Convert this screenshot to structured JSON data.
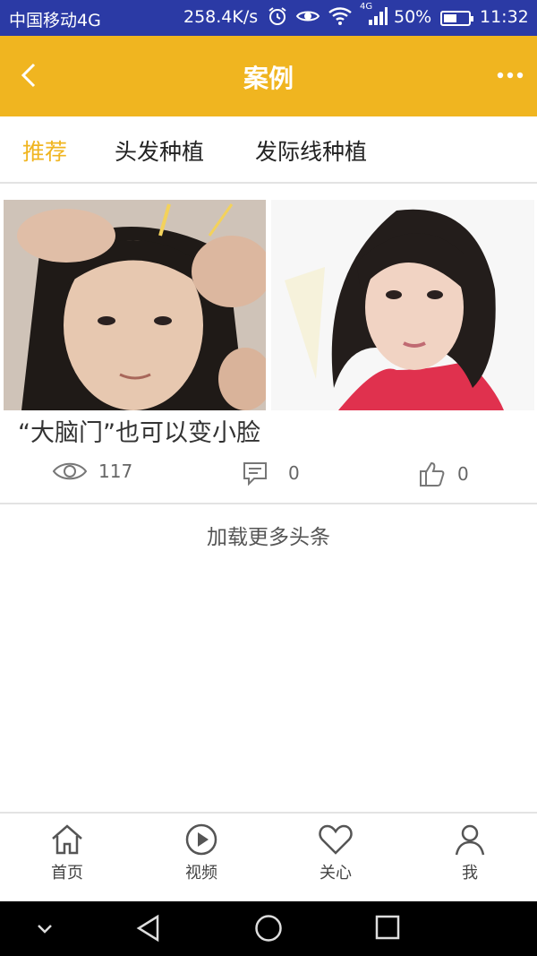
{
  "status_bar": {
    "carrier": "中国移动4G",
    "network_speed": "258.4K/s",
    "network_type": "4G",
    "battery": "50%",
    "battery_level": 0.5,
    "time": "11:32"
  },
  "app_bar": {
    "title": "案例",
    "back_icon": "chevron-left-icon",
    "more_icon": "more-dots-icon",
    "background": "#f0b520"
  },
  "tabs": [
    {
      "label": "推荐",
      "active": true
    },
    {
      "label": "头发种植",
      "active": false
    },
    {
      "label": "发际线种植",
      "active": false
    }
  ],
  "accent_color": "#f0b520",
  "case_card": {
    "title": "“大脑门”也可以变小脸",
    "views": "117",
    "comments": "0",
    "likes": "0",
    "images": [
      "before-photo",
      "after-photo"
    ]
  },
  "load_more": "加载更多头条",
  "bottom_nav": [
    {
      "label": "首页",
      "icon": "home-icon"
    },
    {
      "label": "视频",
      "icon": "play-icon"
    },
    {
      "label": "关心",
      "icon": "heart-icon"
    },
    {
      "label": "我",
      "icon": "user-icon"
    }
  ],
  "system_nav": [
    "collapse-icon",
    "back-triangle-icon",
    "home-circle-icon",
    "recents-square-icon"
  ]
}
